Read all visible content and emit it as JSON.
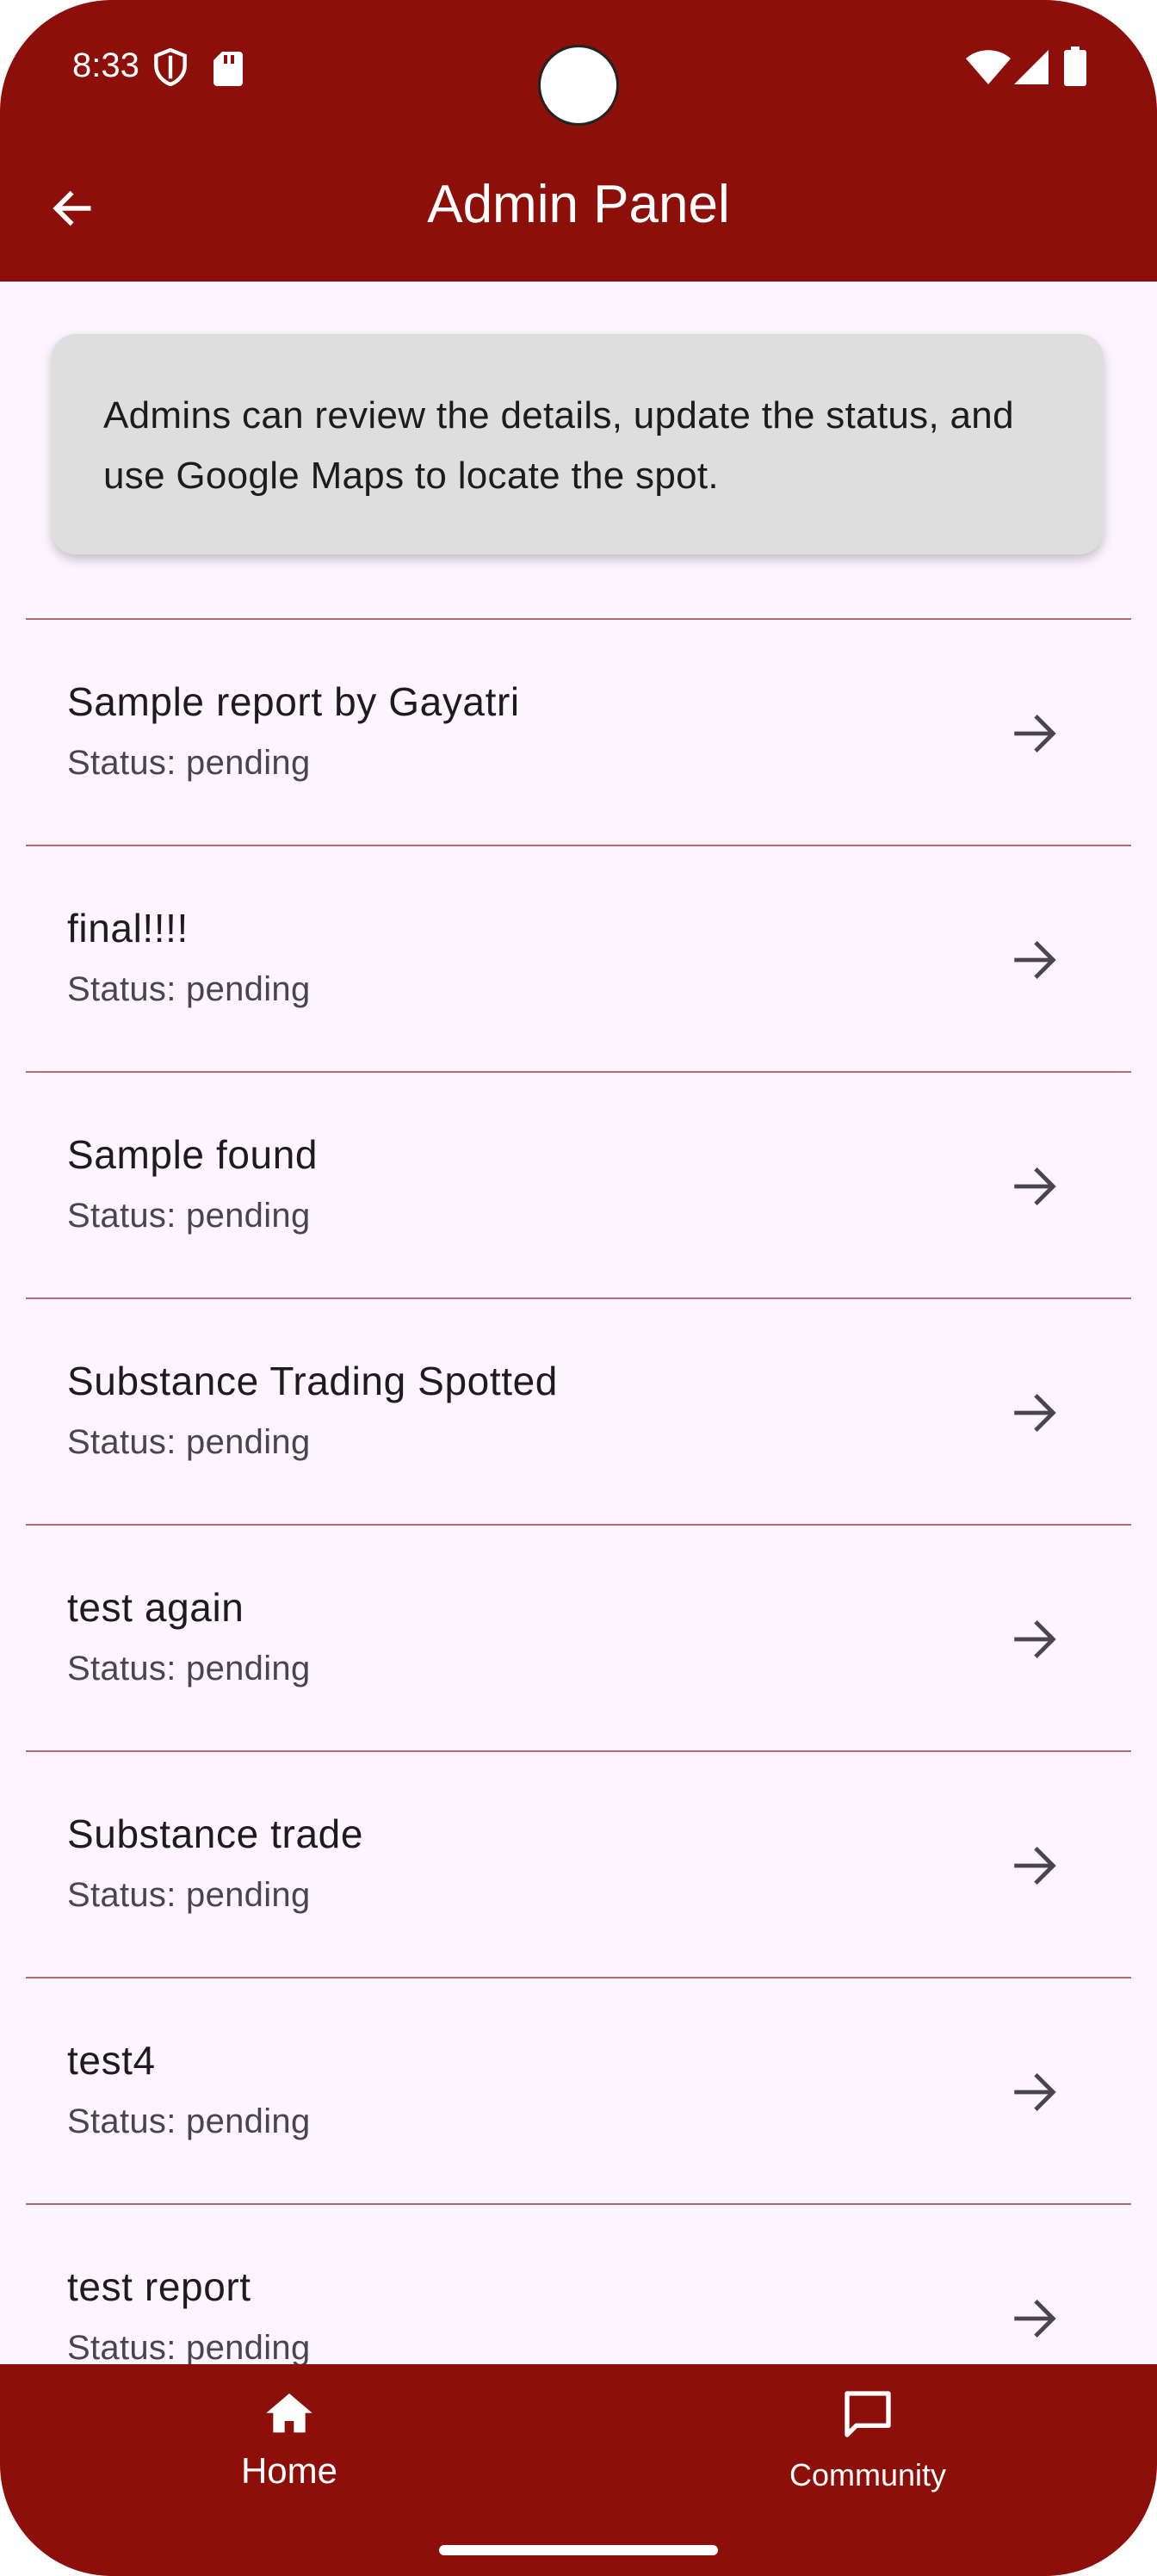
{
  "status_bar": {
    "time": "8:33",
    "left_icons": [
      "shield-icon",
      "sd-card-icon"
    ],
    "right_icons": [
      "wifi-icon",
      "signal-icon",
      "battery-icon"
    ]
  },
  "app_bar": {
    "title": "Admin Panel",
    "back_icon": "arrow-back-icon"
  },
  "info_card": {
    "text": "Admins can review the details, update the status, and use Google Maps to locate the spot."
  },
  "reports": [
    {
      "title": "Sample report by Gayatri",
      "status": "Status: pending"
    },
    {
      "title": "final!!!!",
      "status": "Status: pending"
    },
    {
      "title": "Sample found",
      "status": "Status: pending"
    },
    {
      "title": "Substance Trading Spotted",
      "status": "Status: pending"
    },
    {
      "title": "test again",
      "status": "Status: pending"
    },
    {
      "title": "Substance trade",
      "status": "Status: pending"
    },
    {
      "title": "test4",
      "status": "Status: pending"
    },
    {
      "title": "test report",
      "status": "Status: pending"
    }
  ],
  "bottom_nav": {
    "items": [
      {
        "label": "Home",
        "icon": "home-icon",
        "selected": true
      },
      {
        "label": "Community",
        "icon": "chat-bubble-icon",
        "selected": false
      }
    ]
  },
  "colors": {
    "primary": "#8c0f0a",
    "background": "#fcf5fd",
    "card": "#dedede",
    "divider": "#b56a6c",
    "on_primary": "#ffffff"
  }
}
